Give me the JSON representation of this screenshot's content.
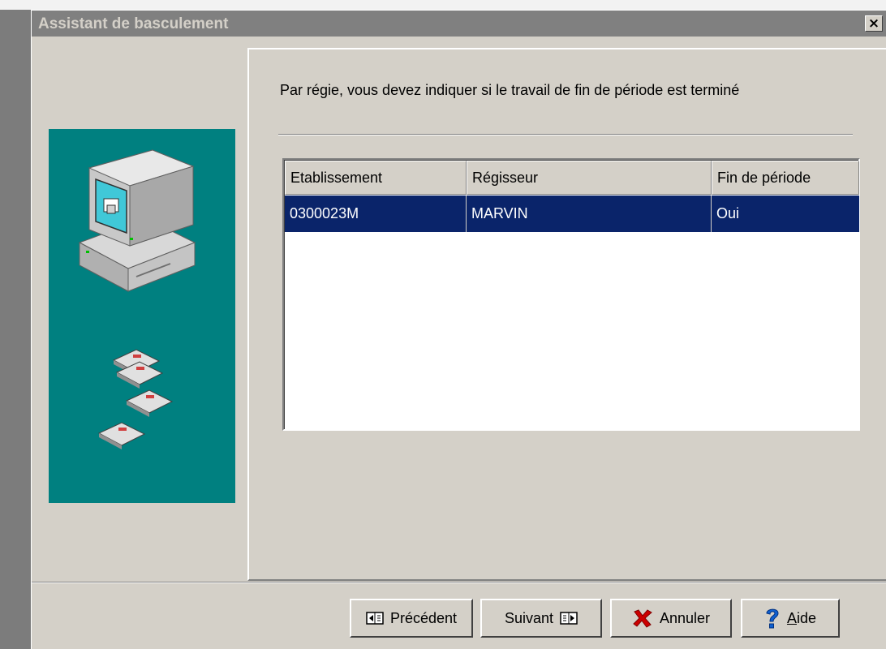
{
  "window": {
    "title": "Assistant de basculement",
    "close_label": "×"
  },
  "wizard": {
    "instruction": "Par régie, vous devez indiquer si le travail de fin de période est terminé"
  },
  "grid": {
    "columns": [
      "Etablissement",
      "Régisseur",
      "Fin de période"
    ],
    "rows": [
      {
        "etablissement": "0300023M",
        "regisseur": "MARVIN",
        "fin_de_periode": "Oui",
        "selected": true
      }
    ]
  },
  "buttons": {
    "previous": {
      "label": "Précédent",
      "icon": "arrow-left-box-icon"
    },
    "next": {
      "label": "Suivant",
      "icon": "arrow-right-box-icon"
    },
    "cancel": {
      "label": "Annuler",
      "icon": "red-x-icon"
    },
    "help": {
      "label": "Aide",
      "icon": "question-mark-icon"
    }
  },
  "illustration": {
    "icons": [
      "computer-icon",
      "floppy-disk-icon"
    ]
  },
  "colors": {
    "titlebar": "#808080",
    "illustration_bg": "#008080",
    "selection": "#0a246a",
    "cancel_icon": "#cc0000",
    "help_icon": "#1060d0"
  }
}
